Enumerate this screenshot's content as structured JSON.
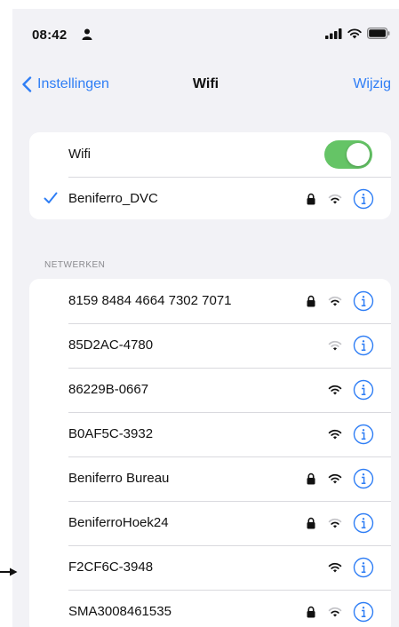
{
  "status_bar": {
    "time": "08:42",
    "icons": [
      "person-icon",
      "cellular-signal-icon",
      "wifi-icon",
      "battery-icon"
    ]
  },
  "nav": {
    "back_label": "Instellingen",
    "title": "Wifi",
    "edit_label": "Wijzig"
  },
  "wifi_toggle": {
    "label": "Wifi",
    "on": true
  },
  "connected": {
    "name": "Beniferro_DVC",
    "secured": true,
    "signal": 2
  },
  "section_header": "NETWERKEN",
  "networks": [
    {
      "name": "8159 8484 4664 7302 7071",
      "secured": true,
      "signal": 2
    },
    {
      "name": "85D2AC-4780",
      "secured": false,
      "signal": 1
    },
    {
      "name": "86229B-0667",
      "secured": false,
      "signal": 3
    },
    {
      "name": "B0AF5C-3932",
      "secured": false,
      "signal": 3
    },
    {
      "name": "Beniferro Bureau",
      "secured": true,
      "signal": 3
    },
    {
      "name": "BeniferroHoek24",
      "secured": true,
      "signal": 2
    },
    {
      "name": "F2CF6C-3948",
      "secured": false,
      "signal": 3
    },
    {
      "name": "SMA3008461535",
      "secured": true,
      "signal": 2
    }
  ],
  "colors": {
    "accent": "#2f7ef5",
    "toggle_on": "#65c466",
    "background": "#f2f2f6",
    "card": "#ffffff"
  }
}
